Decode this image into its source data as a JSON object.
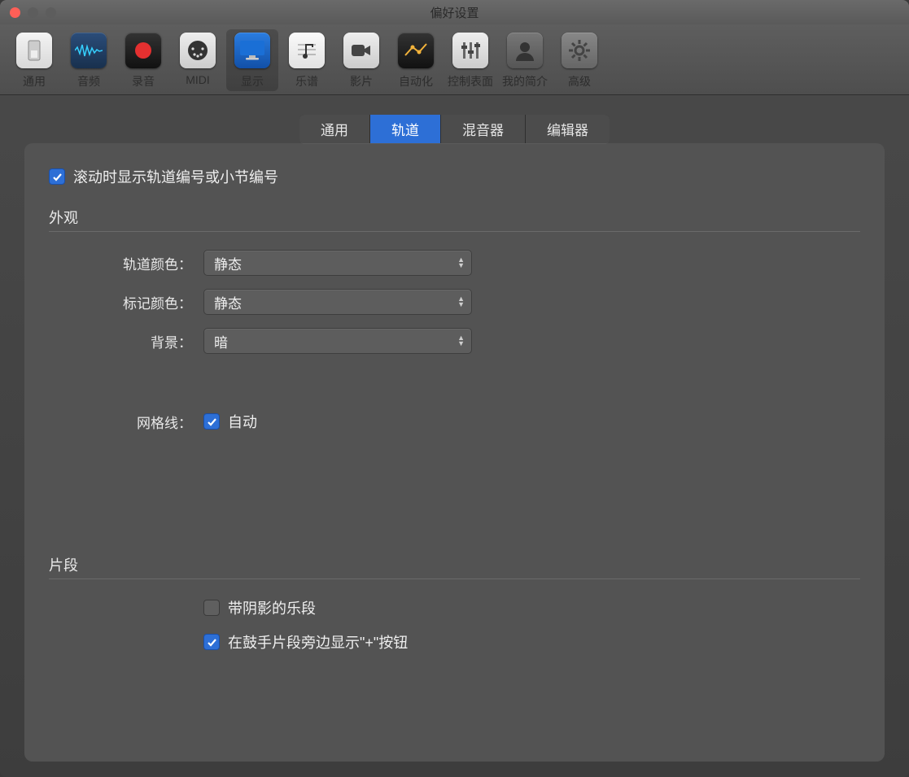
{
  "window": {
    "title": "偏好设置"
  },
  "toolbar": {
    "items": [
      {
        "label": "通用",
        "name": "general"
      },
      {
        "label": "音频",
        "name": "audio"
      },
      {
        "label": "录音",
        "name": "record"
      },
      {
        "label": "MIDI",
        "name": "midi"
      },
      {
        "label": "显示",
        "name": "display",
        "selected": true
      },
      {
        "label": "乐谱",
        "name": "score"
      },
      {
        "label": "影片",
        "name": "video"
      },
      {
        "label": "自动化",
        "name": "automation"
      },
      {
        "label": "控制表面",
        "name": "surface"
      },
      {
        "label": "我的简介",
        "name": "profile"
      },
      {
        "label": "高级",
        "name": "advanced"
      }
    ]
  },
  "tabs": {
    "items": [
      {
        "label": "通用"
      },
      {
        "label": "轨道",
        "active": true
      },
      {
        "label": "混音器"
      },
      {
        "label": "编辑器"
      }
    ]
  },
  "content": {
    "scroll_checkbox_label": "滚动时显示轨道编号或小节编号",
    "appearance_section": "外观",
    "track_color_label": "轨道颜色：",
    "track_color_value": "静态",
    "marker_color_label": "标记颜色：",
    "marker_color_value": "静态",
    "background_label": "背景：",
    "background_value": "暗",
    "gridlines_label": "网格线：",
    "gridlines_checkbox_label": "自动",
    "segment_section": "片段",
    "shadow_checkbox_label": "带阴影的乐段",
    "drummer_checkbox_label": "在鼓手片段旁边显示\"+\"按钮"
  }
}
